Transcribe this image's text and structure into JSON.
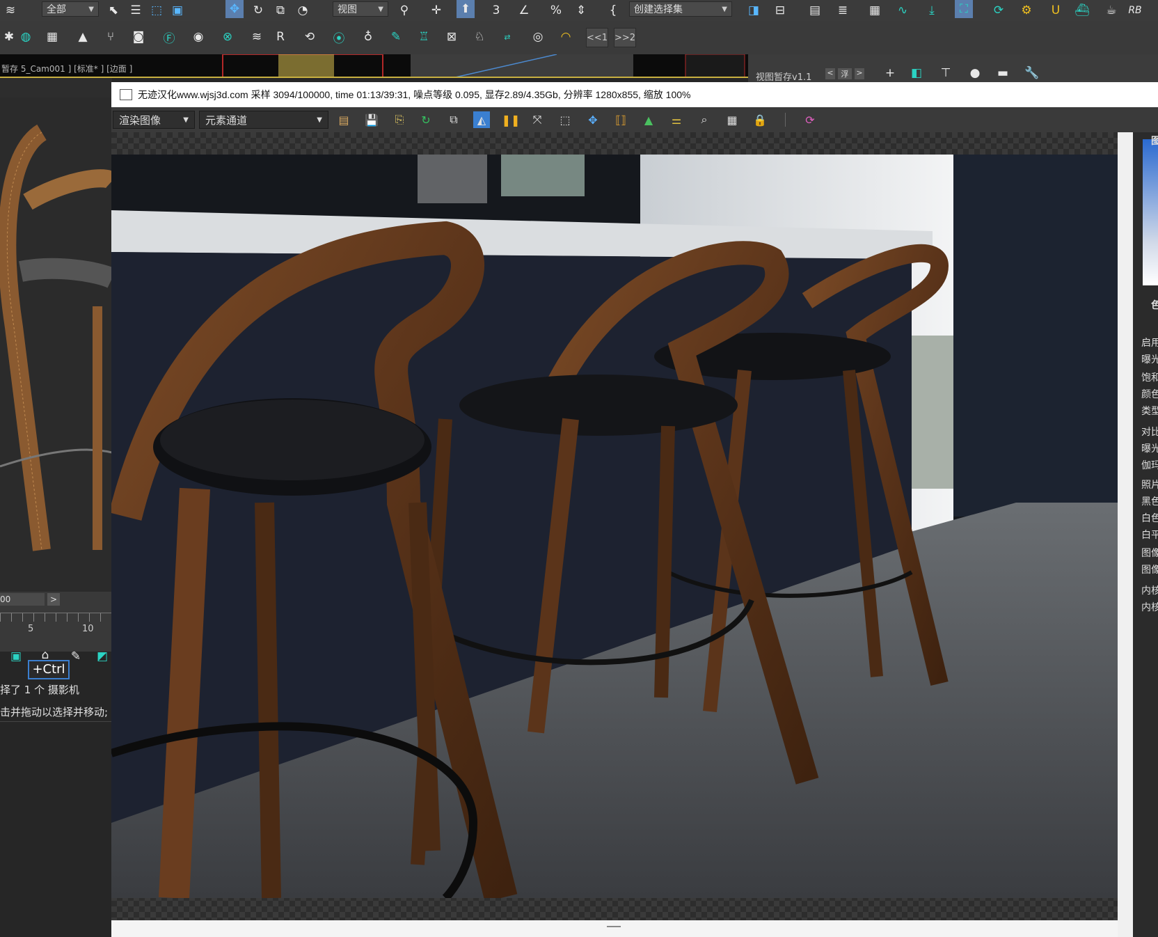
{
  "toolbar1": {
    "filter_combo": "全部",
    "ref_coord_combo": "视图",
    "selection_set_combo": "创建选择集",
    "rb_label": "RB"
  },
  "toolbar2": {
    "prev_label": "<<1",
    "next_label": ">>2"
  },
  "viewport": {
    "label": "暂存 5_Cam001 ] [标准* ] [边面 ]",
    "right_strip_label": "视图暂存v1.1",
    "strip_prev": "<",
    "strip_float": "浮",
    "strip_next": ">"
  },
  "timeline": {
    "frame_value": "00",
    "next_frame": ">",
    "tick_5": "5",
    "tick_10": "10"
  },
  "left_panel": {
    "ctrl_tooltip": "+Ctrl",
    "status_line1": "择了 1 个 摄影机",
    "status_line2": "击并拖动以选择并移动;"
  },
  "vfb": {
    "title": "无迹汉化www.wjsj3d.com  采样 3094/100000,  time 01:13/39:31,  噪点等级 0.095,  显存2.89/4.35Gb,  分辨率 1280x855,  缩放 100%",
    "render_combo": "渲染图像",
    "channel_combo": "元素通道"
  },
  "right_panel": {
    "items": [
      "图",
      "色",
      "启用",
      "曝光",
      "饱和",
      "颜色",
      "类型",
      "对比",
      "曝光",
      "伽玛",
      "照片",
      "黑色",
      "白色",
      "白平",
      "图像",
      "图像",
      "内核",
      "内核"
    ]
  }
}
